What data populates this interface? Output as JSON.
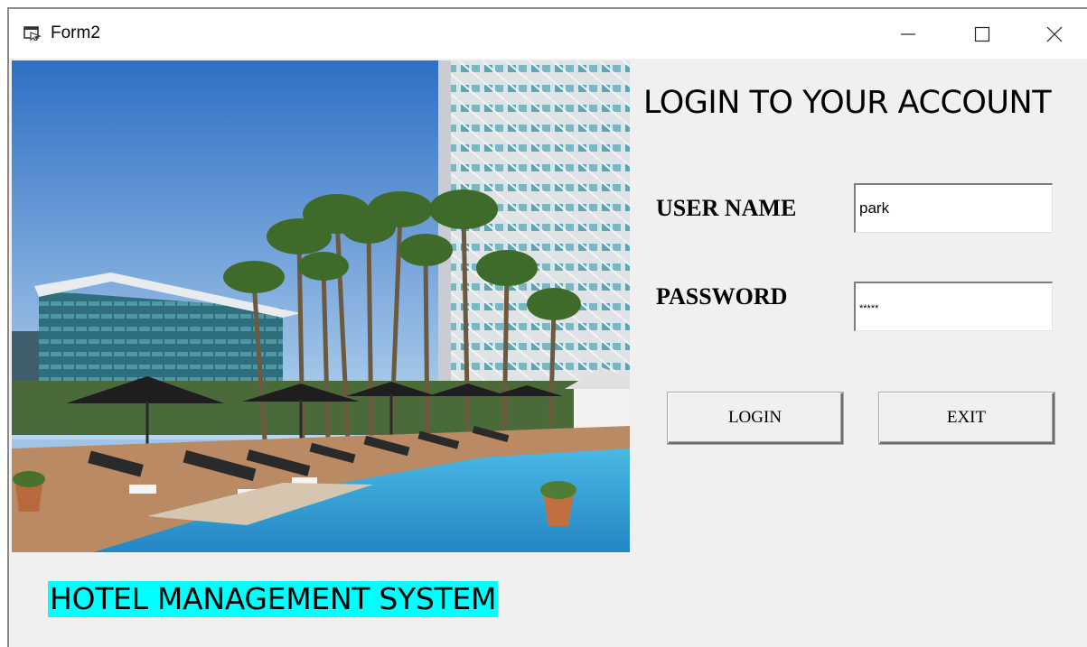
{
  "window": {
    "title": "Form2",
    "controls": {
      "minimize": "minimize-icon",
      "maximize": "maximize-icon",
      "close": "close-icon"
    }
  },
  "image": {
    "subject": "hotel-pool-photo"
  },
  "form": {
    "heading": "LOGIN TO YOUR ACCOUNT",
    "username_label": "USER NAME",
    "username_value": "park",
    "password_label": "PASSWORD",
    "password_value": "*****",
    "login_button": "LOGIN",
    "exit_button": "EXIT"
  },
  "banner": {
    "text": "HOTEL MANAGEMENT SYSTEM",
    "background_color": "#00ffff"
  }
}
